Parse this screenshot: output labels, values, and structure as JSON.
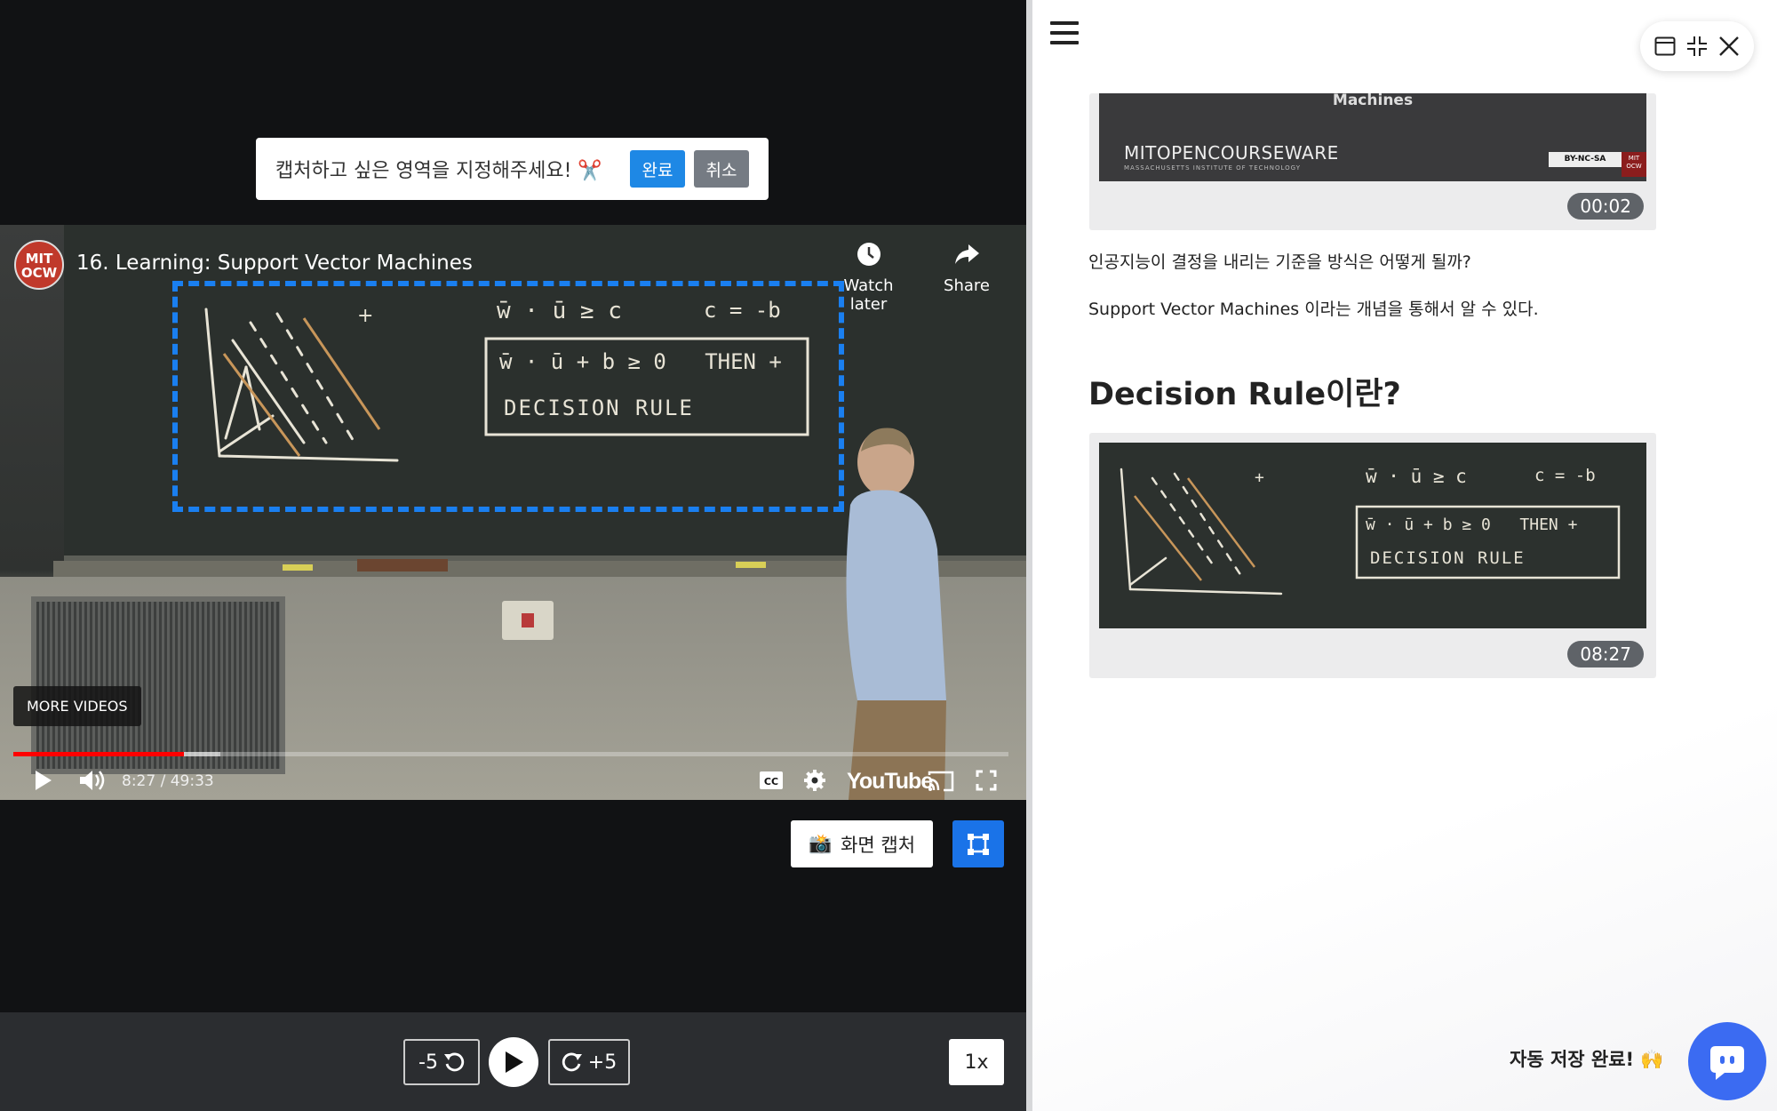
{
  "capture_prompt": {
    "text": "캡처하고 싶은 영역을 지정해주세요! ✂️",
    "ok_label": "완료",
    "cancel_label": "취소"
  },
  "video": {
    "channel_logo": "MIT OCW",
    "title": "16. Learning: Support Vector Machines",
    "watch_later_label": "Watch later",
    "share_label": "Share",
    "more_videos_label": "MORE VIDEOS",
    "time_display": "8:27 / 49:33",
    "youtube_label": "YouTube",
    "progress_played_fraction": 0.171,
    "progress_buffered_fraction": 0.208
  },
  "board": {
    "eq1": "w̄ · ū ≥ c",
    "eq2": "c = -b",
    "rule_line": "w̄ · ū + b ≥ 0   THEN +",
    "rule_name": "DECISION RULE",
    "plus": "+"
  },
  "toolbar": {
    "capture_label": "화면 캡처",
    "capture_emoji": "📸"
  },
  "playback": {
    "back_label": "-5",
    "forward_label": "+5",
    "speed_label": "1x"
  },
  "notes": {
    "card1_title": "Machines",
    "card1_brand": "MITOPENCOURSEWARE",
    "card1_brand_sub": "MASSACHUSETTS INSTITUTE OF TECHNOLOGY",
    "card1_license": "BY-NC-SA",
    "card1_badge_text": "MIT OCW",
    "card1_time": "00:02",
    "para1": "인공지능이 결정을 내리는 기준을 방식은 어떻게 될까?",
    "para2": "Support Vector Machines 이라는 개념을 통해서 알 수 있다.",
    "heading": "Decision Rule이란?",
    "card2_time": "08:27"
  },
  "footer": {
    "autosave_label": "자동 저장 완료! 🙌"
  },
  "colors": {
    "accent_blue": "#1e88e5",
    "selection_blue": "#1a7ff0",
    "progress_red": "#ff0000",
    "chat_blue": "#3b6bf2"
  },
  "icons": [
    "menu-icon",
    "window-icon",
    "minimize-icon",
    "close-icon",
    "play-icon",
    "volume-icon",
    "cc-icon",
    "settings-icon",
    "cast-icon",
    "fullscreen-icon",
    "clock-icon",
    "share-icon",
    "region-select-icon",
    "rewind-icon",
    "forward-icon",
    "chat-icon"
  ]
}
